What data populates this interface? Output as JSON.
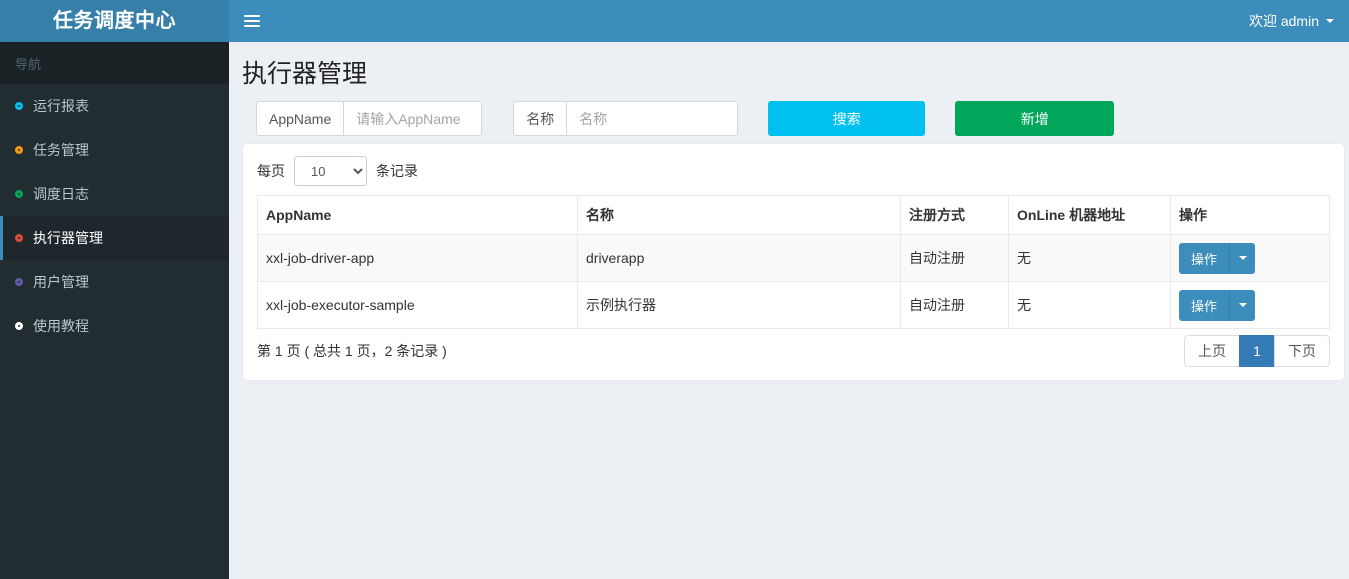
{
  "colors": {
    "navbar": "#3c8dbc",
    "logo_bg": "#367fa9",
    "sidebar_bg": "#222d32",
    "search_button": "#00c0ef",
    "add_button": "#00a65a",
    "action_button": "#3c8dbc",
    "pagination_active": "#337ab7"
  },
  "header": {
    "logo": "任务调度中心",
    "welcome": "欢迎 admin"
  },
  "sidebar": {
    "section_label": "导航",
    "items": [
      {
        "label": "运行报表",
        "icon": "circle-o-icon",
        "icon_color": "#00c0ef",
        "active": false
      },
      {
        "label": "任务管理",
        "icon": "circle-o-icon",
        "icon_color": "#f39c12",
        "active": false
      },
      {
        "label": "调度日志",
        "icon": "circle-o-icon",
        "icon_color": "#00a65a",
        "active": false
      },
      {
        "label": "执行器管理",
        "icon": "circle-o-icon",
        "icon_color": "#dd4b39",
        "active": true
      },
      {
        "label": "用户管理",
        "icon": "circle-o-icon",
        "icon_color": "#605ca8",
        "active": false
      },
      {
        "label": "使用教程",
        "icon": "circle-o-icon",
        "icon_color": "#ffffff",
        "active": false
      }
    ]
  },
  "page": {
    "title": "执行器管理"
  },
  "filters": {
    "appname_label": "AppName",
    "appname_placeholder": "请输入AppName",
    "name_label": "名称",
    "name_placeholder": "名称",
    "search_label": "搜索",
    "add_label": "新增"
  },
  "page_size": {
    "prefix": "每页",
    "value": "10",
    "suffix": "条记录"
  },
  "table": {
    "columns": [
      "AppName",
      "名称",
      "注册方式",
      "OnLine 机器地址",
      "操作"
    ],
    "action_label": "操作",
    "rows": [
      {
        "appname": "xxl-job-driver-app",
        "name": "driverapp",
        "registry": "自动注册",
        "online": "无"
      },
      {
        "appname": "xxl-job-executor-sample",
        "name": "示例执行器",
        "registry": "自动注册",
        "online": "无"
      }
    ]
  },
  "pagination": {
    "summary": "第 1 页 ( 总共 1 页，2 条记录 )",
    "prev": "上页",
    "current": "1",
    "next": "下页"
  }
}
